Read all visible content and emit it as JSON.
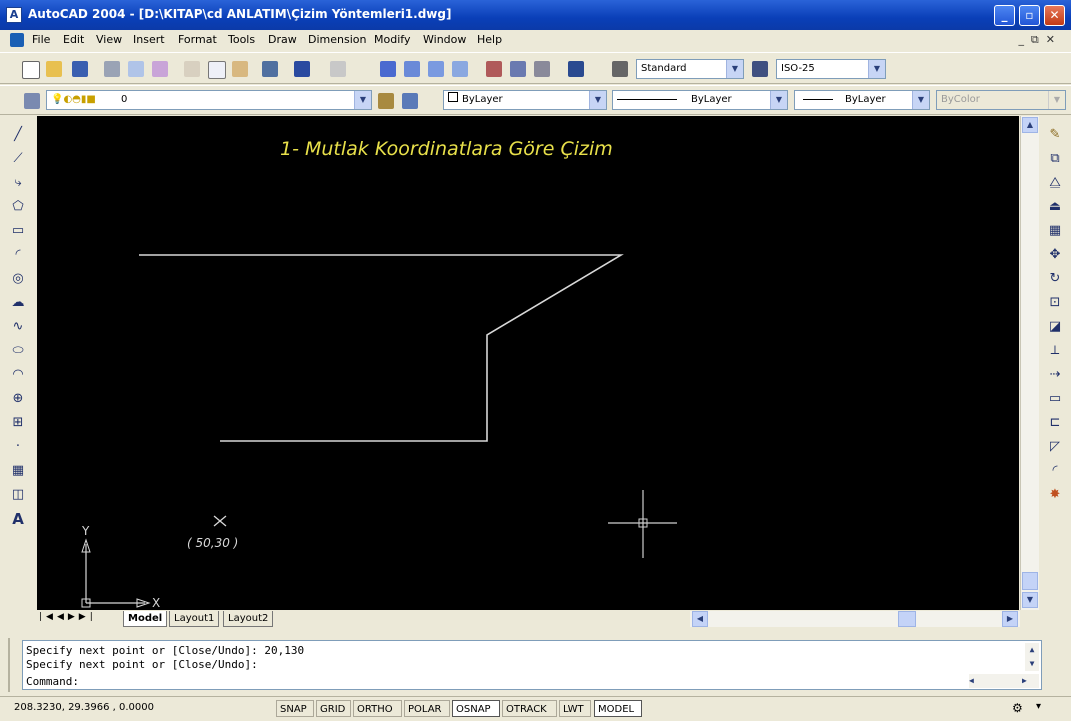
{
  "window": {
    "title": "AutoCAD 2004 - [D:\\KITAP\\cd ANLATIM\\Çizim Yöntemleri1.dwg]",
    "app_icon_letter": "A"
  },
  "menu": {
    "items": [
      "File",
      "Edit",
      "View",
      "Insert",
      "Format",
      "Tools",
      "Draw",
      "Dimension",
      "Modify",
      "Window",
      "Help"
    ]
  },
  "standard_toolbar": {
    "text_style": "Standard",
    "dim_style": "ISO-25"
  },
  "layers_toolbar": {
    "layer": "0",
    "color": "ByLayer",
    "linetype": "ByLayer",
    "lineweight": "ByLayer",
    "plotstyle": "ByColor"
  },
  "drawing": {
    "heading": "1- Mutlak Koordinatlara Göre Çizim",
    "point_label": "( 50,30 )",
    "ucs_x": "X",
    "ucs_y": "Y",
    "colors": {
      "background": "#000000",
      "lines": "#d8d8d8",
      "heading": "#e8e04a"
    }
  },
  "layout_tabs": [
    "Model",
    "Layout1",
    "Layout2"
  ],
  "command_line": {
    "lines": [
      "Specify next point or [Close/Undo]: 20,130",
      "Specify next point or [Close/Undo]:",
      "Command:"
    ]
  },
  "status_bar": {
    "coordinates": "208.3230, 29.3966 , 0.0000",
    "toggles": [
      {
        "label": "SNAP",
        "on": false
      },
      {
        "label": "GRID",
        "on": false
      },
      {
        "label": "ORTHO",
        "on": false
      },
      {
        "label": "POLAR",
        "on": false
      },
      {
        "label": "OSNAP",
        "on": true
      },
      {
        "label": "OTRACK",
        "on": false
      },
      {
        "label": "LWT",
        "on": false
      },
      {
        "label": "MODEL",
        "on": true
      }
    ]
  }
}
